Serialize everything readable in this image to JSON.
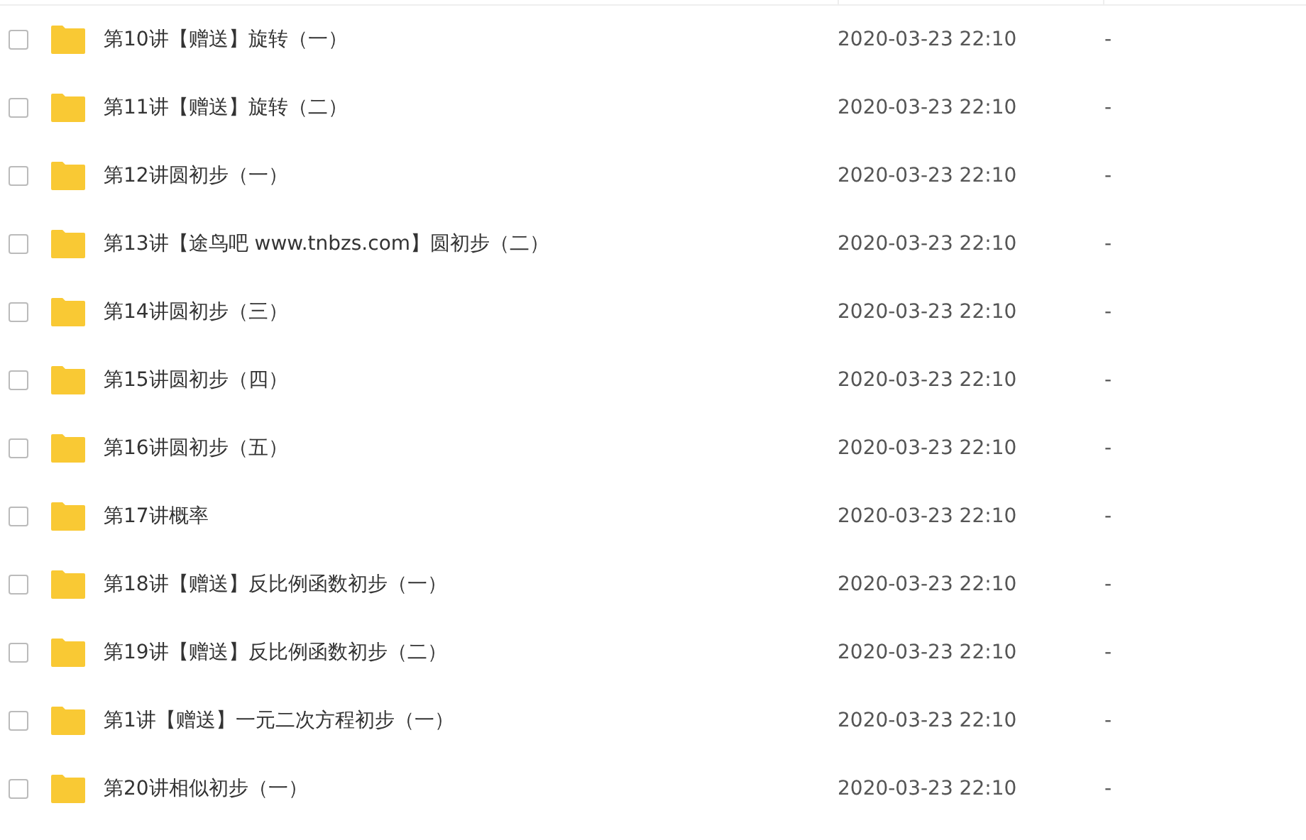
{
  "files": [
    {
      "name": "第10讲【赠送】旋转（一）",
      "modified": "2020-03-23 22:10",
      "size": "-",
      "checked": false
    },
    {
      "name": "第11讲【赠送】旋转（二）",
      "modified": "2020-03-23 22:10",
      "size": "-",
      "checked": false
    },
    {
      "name": "第12讲圆初步（一）",
      "modified": "2020-03-23 22:10",
      "size": "-",
      "checked": false
    },
    {
      "name": "第13讲【途鸟吧 www.tnbzs.com】圆初步（二）",
      "modified": "2020-03-23 22:10",
      "size": "-",
      "checked": false
    },
    {
      "name": "第14讲圆初步（三）",
      "modified": "2020-03-23 22:10",
      "size": "-",
      "checked": false
    },
    {
      "name": "第15讲圆初步（四）",
      "modified": "2020-03-23 22:10",
      "size": "-",
      "checked": false
    },
    {
      "name": "第16讲圆初步（五）",
      "modified": "2020-03-23 22:10",
      "size": "-",
      "checked": false
    },
    {
      "name": "第17讲概率",
      "modified": "2020-03-23 22:10",
      "size": "-",
      "checked": false
    },
    {
      "name": "第18讲【赠送】反比例函数初步（一）",
      "modified": "2020-03-23 22:10",
      "size": "-",
      "checked": false
    },
    {
      "name": "第19讲【赠送】反比例函数初步（二）",
      "modified": "2020-03-23 22:10",
      "size": "-",
      "checked": false
    },
    {
      "name": "第1讲【赠送】一元二次方程初步（一）",
      "modified": "2020-03-23 22:10",
      "size": "-",
      "checked": false
    },
    {
      "name": "第20讲相似初步（一）",
      "modified": "2020-03-23 22:10",
      "size": "-",
      "checked": false
    }
  ]
}
